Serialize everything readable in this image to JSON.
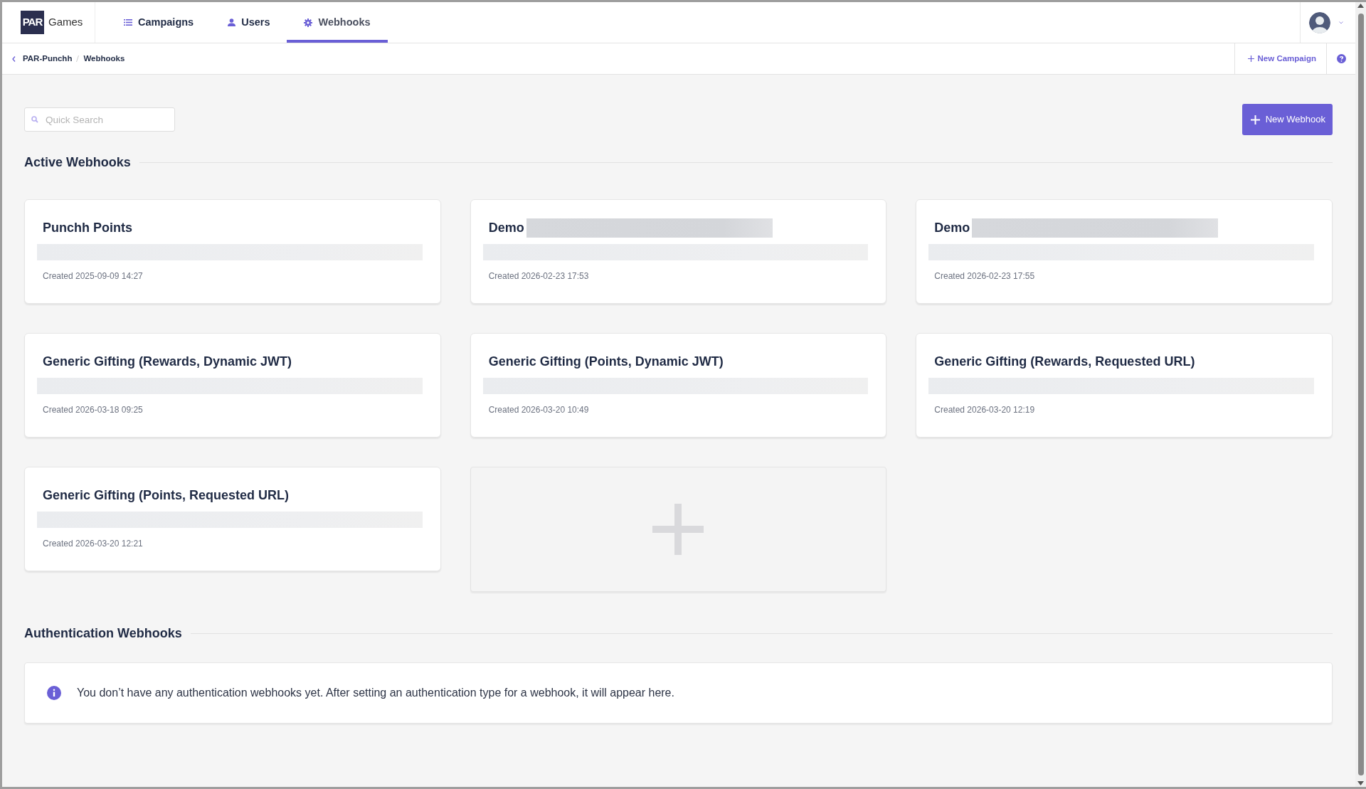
{
  "nav": {
    "logo": {
      "mark": "PAR",
      "text": "Games"
    },
    "tabs": [
      {
        "label": "Campaigns",
        "selected": false
      },
      {
        "label": "Users",
        "selected": false
      },
      {
        "label": "Webhooks",
        "selected": true
      }
    ]
  },
  "breadcrumb": [
    "PAR-Punchh",
    "Webhooks"
  ],
  "actions": {
    "new_campaign": "New Campaign"
  },
  "search": {
    "placeholder": "Quick Search"
  },
  "new_webhook": "New Webhook",
  "active": {
    "heading": "Active Webhooks",
    "cards": [
      {
        "kind": "webhook",
        "title": "Punchh Points",
        "title_redacted": false,
        "created": "Created 2025-09-09 14:27"
      },
      {
        "kind": "webhook",
        "title": "Demo",
        "title_redacted": true,
        "created": "Created 2026-02-23 17:53"
      },
      {
        "kind": "webhook",
        "title": "Demo",
        "title_redacted": true,
        "created": "Created 2026-02-23 17:55"
      },
      {
        "kind": "webhook",
        "title": "Generic Gifting (Rewards, Dynamic JWT)",
        "title_redacted": false,
        "created": "Created 2026-03-18 09:25"
      },
      {
        "kind": "webhook",
        "title": "Generic Gifting (Points, Dynamic JWT)",
        "title_redacted": false,
        "created": "Created 2026-03-20 10:49"
      },
      {
        "kind": "webhook",
        "title": "Generic Gifting (Rewards, Requested URL)",
        "title_redacted": false,
        "created": "Created 2026-03-20 12:19"
      },
      {
        "kind": "webhook",
        "title": "Generic Gifting (Points, Requested URL)",
        "title_redacted": false,
        "created": "Created 2026-03-20 12:21"
      },
      {
        "kind": "add"
      }
    ]
  },
  "auth": {
    "heading": "Authentication Webhooks",
    "message": "You don’t have any authentication webhooks yet. After setting an authentication type for a webhook, it will appear here."
  }
}
